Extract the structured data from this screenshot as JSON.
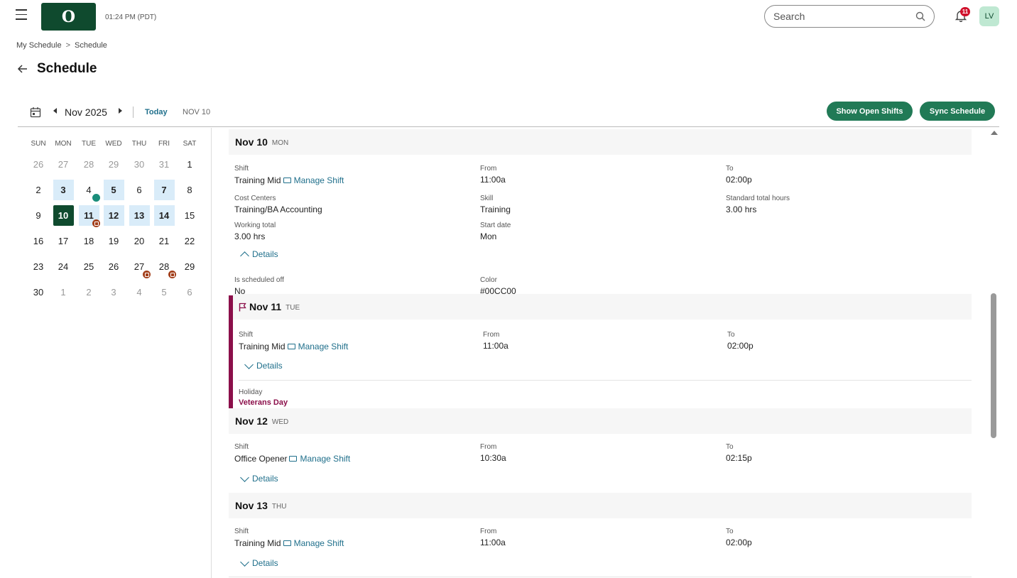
{
  "header": {
    "logo_text": "O",
    "time": "01:24 PM (PDT)",
    "search_placeholder": "Search",
    "notification_count": "11",
    "avatar_initials": "LV"
  },
  "breadcrumb": [
    "My Schedule",
    "Schedule"
  ],
  "breadcrumb_sep": ">",
  "page_title": "Schedule",
  "toolbar": {
    "month": "Nov 2025",
    "today_label": "Today",
    "date_label": "NOV 10",
    "show_open_shifts": "Show Open Shifts",
    "sync_schedule": "Sync Schedule"
  },
  "mini_calendar": {
    "weekdays": [
      "SUN",
      "MON",
      "TUE",
      "WED",
      "THU",
      "FRI",
      "SAT"
    ],
    "weeks": [
      [
        "26",
        "27",
        "28",
        "29",
        "30",
        "31",
        "1"
      ],
      [
        "2",
        "3",
        "4",
        "5",
        "6",
        "7",
        "8"
      ],
      [
        "9",
        "10",
        "11",
        "12",
        "13",
        "14",
        "15"
      ],
      [
        "16",
        "17",
        "18",
        "19",
        "20",
        "21",
        "22"
      ],
      [
        "23",
        "24",
        "25",
        "26",
        "27",
        "28",
        "29"
      ],
      [
        "30",
        "1",
        "2",
        "3",
        "4",
        "5",
        "6"
      ]
    ],
    "selected": "10",
    "shift_days": [
      "3",
      "5",
      "7",
      "11",
      "12",
      "13",
      "14"
    ]
  },
  "days": [
    {
      "date": "Nov 10",
      "dow": "MON",
      "shift_label": "Shift",
      "shift": "Training Mid",
      "manage": "Manage Shift",
      "from_label": "From",
      "from": "11:00a",
      "to_label": "To",
      "to": "02:00p",
      "cost_centers_label": "Cost Centers",
      "cost_centers": "Training/BA Accounting",
      "skill_label": "Skill",
      "skill": "Training",
      "std_hours_label": "Standard total hours",
      "std_hours": "3.00 hrs",
      "working_total_label": "Working total",
      "working_total": "3.00 hrs",
      "start_date_label": "Start date",
      "start_date": "Mon",
      "details": "Details",
      "sched_off_label": "Is scheduled off",
      "sched_off": "No",
      "color_label": "Color",
      "color": "#00CC00"
    },
    {
      "date": "Nov 11",
      "dow": "TUE",
      "shift_label": "Shift",
      "shift": "Training Mid",
      "manage": "Manage Shift",
      "from_label": "From",
      "from": "11:00a",
      "to_label": "To",
      "to": "02:00p",
      "details": "Details",
      "holiday_label": "Holiday",
      "holiday": "Veterans Day"
    },
    {
      "date": "Nov 12",
      "dow": "WED",
      "shift_label": "Shift",
      "shift": "Office Opener",
      "manage": "Manage Shift",
      "from_label": "From",
      "from": "10:30a",
      "to_label": "To",
      "to": "02:15p",
      "details": "Details"
    },
    {
      "date": "Nov 13",
      "dow": "THU",
      "shift_label": "Shift",
      "shift": "Training Mid",
      "manage": "Manage Shift",
      "from_label": "From",
      "from": "11:00a",
      "to_label": "To",
      "to": "02:00p",
      "details": "Details"
    }
  ],
  "colors": {
    "brand": "#0f4a2e",
    "button": "#217a56",
    "link": "#1f6f8b",
    "holiday": "#8b0f4a",
    "badge": "#d0102b"
  }
}
